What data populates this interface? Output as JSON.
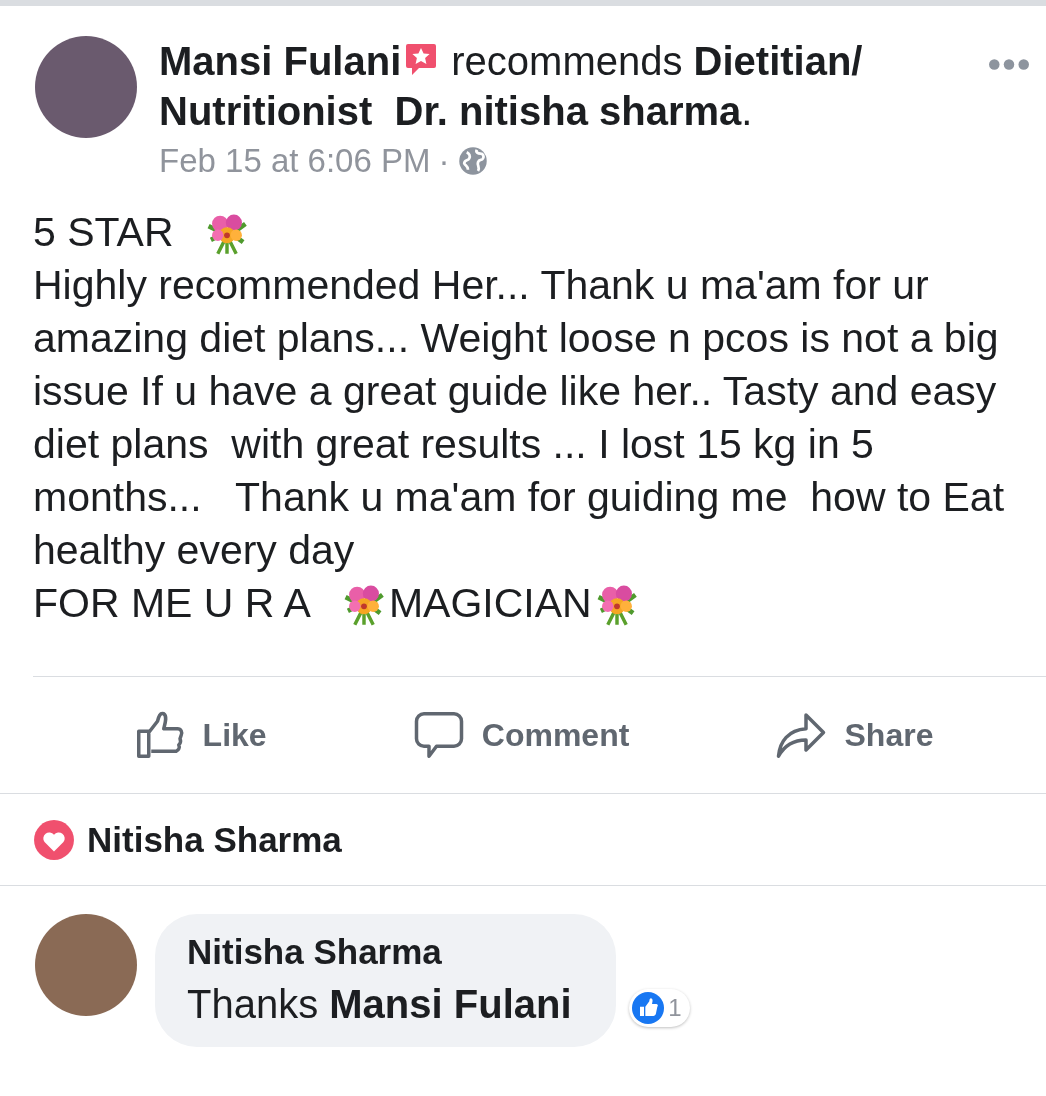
{
  "post": {
    "author": "Mansi Fulani",
    "recommendation": [
      "recommends **Dietitian/**",
      "**Nutritionist  Dr. nitisha sharma**."
    ],
    "timestamp": "Feb 15 at 6:06 PM",
    "separator": "·",
    "body": [
      {
        "parts": [
          {
            "kind": "text",
            "text": "5 STAR"
          },
          {
            "kind": "bouquet"
          }
        ]
      },
      {
        "parts": [
          {
            "kind": "text",
            "text": "Highly recommended Her... Thank u ma'am for ur amazing diet plans... Weight loose n pcos is not a big issue If u have a great guide like her.. Tasty and easy diet plans  with great results ... I lost 15 kg in 5 months...   Thank u ma'am for guiding me  how to Eat healthy every day"
          }
        ]
      },
      {
        "parts": [
          {
            "kind": "text",
            "text": "FOR ME U R A"
          },
          {
            "kind": "bouquet"
          },
          {
            "kind": "text",
            "text": "MAGICIAN"
          },
          {
            "kind": "bouquet"
          }
        ]
      }
    ]
  },
  "actions": [
    {
      "kind": "like",
      "label": "Like"
    },
    {
      "kind": "comment",
      "label": "Comment"
    },
    {
      "kind": "share",
      "label": "Share"
    }
  ],
  "reaction": {
    "kind": "love",
    "name": "Nitisha Sharma"
  },
  "comment": {
    "author": "Nitisha Sharma",
    "text": "Thanks **Mansi Fulani**",
    "likes": "1"
  }
}
